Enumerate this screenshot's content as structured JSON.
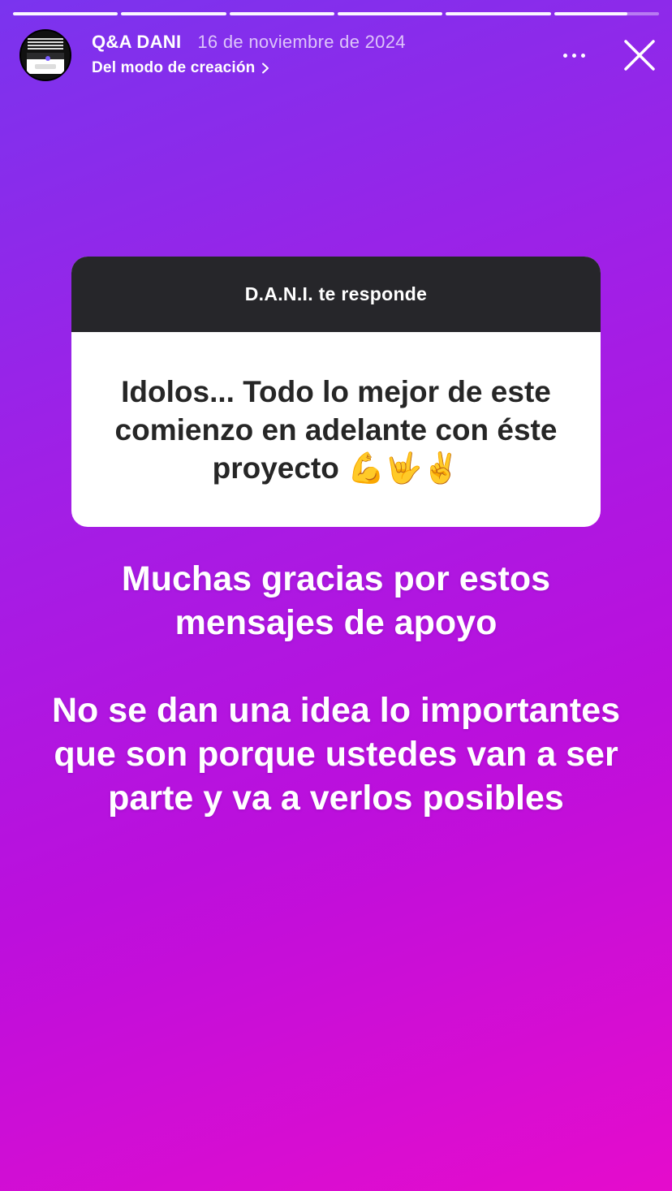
{
  "progress": {
    "segments": 6,
    "active_index": 5,
    "active_fraction": 0.7
  },
  "header": {
    "username": "Q&A DANI",
    "date": "16 de noviembre de 2024",
    "subtitle": "Del modo de creación"
  },
  "card": {
    "title": "D.A.N.I. te responde",
    "question": "Idolos... Todo lo mejor de este comienzo en adelante con éste proyecto 💪🤟✌️"
  },
  "story": {
    "text_1": "Muchas gracias por estos mensajes de apoyo",
    "text_2": "No se dan una idea lo importantes que son porque ustedes van a ser parte y va a verlos posibles"
  },
  "colors": {
    "gradient_start": "#7a34ee",
    "gradient_end": "#e50ccc",
    "card_header": "#26262a"
  },
  "icons": [
    "more-options-icon",
    "close-icon",
    "chevron-right-icon"
  ]
}
